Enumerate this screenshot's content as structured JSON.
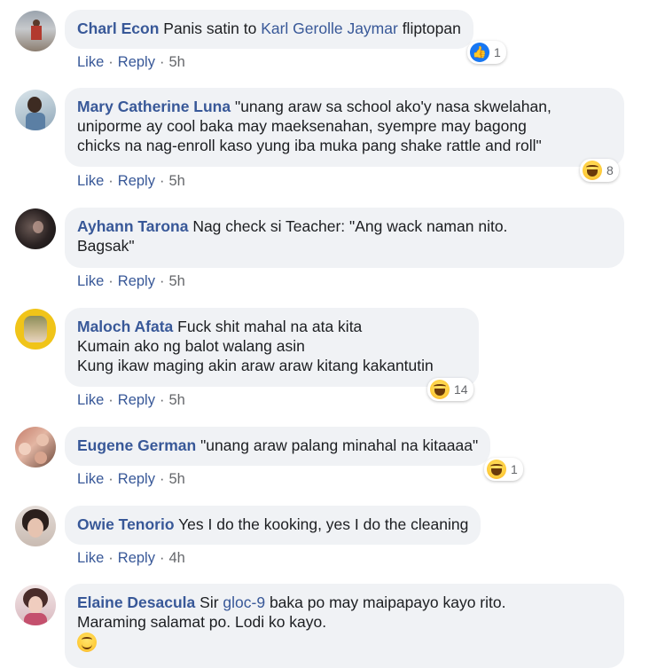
{
  "actions": {
    "like": "Like",
    "reply": "Reply",
    "sep": "·"
  },
  "comments": [
    {
      "author": "Charl Econ",
      "text_before": "Panis satin to ",
      "mention": "Karl Gerolle Jaymar",
      "text_after": " fliptopan",
      "time": "5h",
      "reaction": {
        "icon": "like-icon",
        "count": "1"
      }
    },
    {
      "author": "Mary Catherine Luna",
      "lines": [
        "\"unang araw sa school ako'y nasa skwelahan,",
        "uniporme ay cool baka may maeksenahan, syempre may bagong",
        "chicks na nag-enroll kaso yung iba muka pang shake rattle and roll\""
      ],
      "time": "5h",
      "reaction": {
        "icon": "haha-icon",
        "count": "8"
      }
    },
    {
      "author": "Ayhann Tarona",
      "lines": [
        "Nag check si Teacher: \"Ang wack naman nito.",
        "Bagsak\""
      ],
      "time": "5h"
    },
    {
      "author": "Maloch Afata",
      "lines": [
        "Fuck shit mahal na ata kita",
        "Kumain ako ng balot walang asin",
        "Kung ikaw maging akin araw araw kitang kakantutin"
      ],
      "time": "5h",
      "reaction": {
        "icon": "haha-icon",
        "count": "14"
      }
    },
    {
      "author": "Eugene German",
      "lines": [
        "\"unang araw palang minahal na kitaaaa\""
      ],
      "time": "5h",
      "reaction": {
        "icon": "haha-icon",
        "count": "1"
      }
    },
    {
      "author": "Owie Tenorio",
      "lines": [
        "Yes I do the kooking, yes I do the cleaning"
      ],
      "time": "4h"
    },
    {
      "author": "Elaine Desacula",
      "text_before": "Sir ",
      "mention": "gloc-9",
      "text_after": " baka po may maipapayo kayo rito.",
      "line2": "Maraming salamat po. Lodi ko kayo.",
      "emoji": "smile-icon"
    }
  ]
}
